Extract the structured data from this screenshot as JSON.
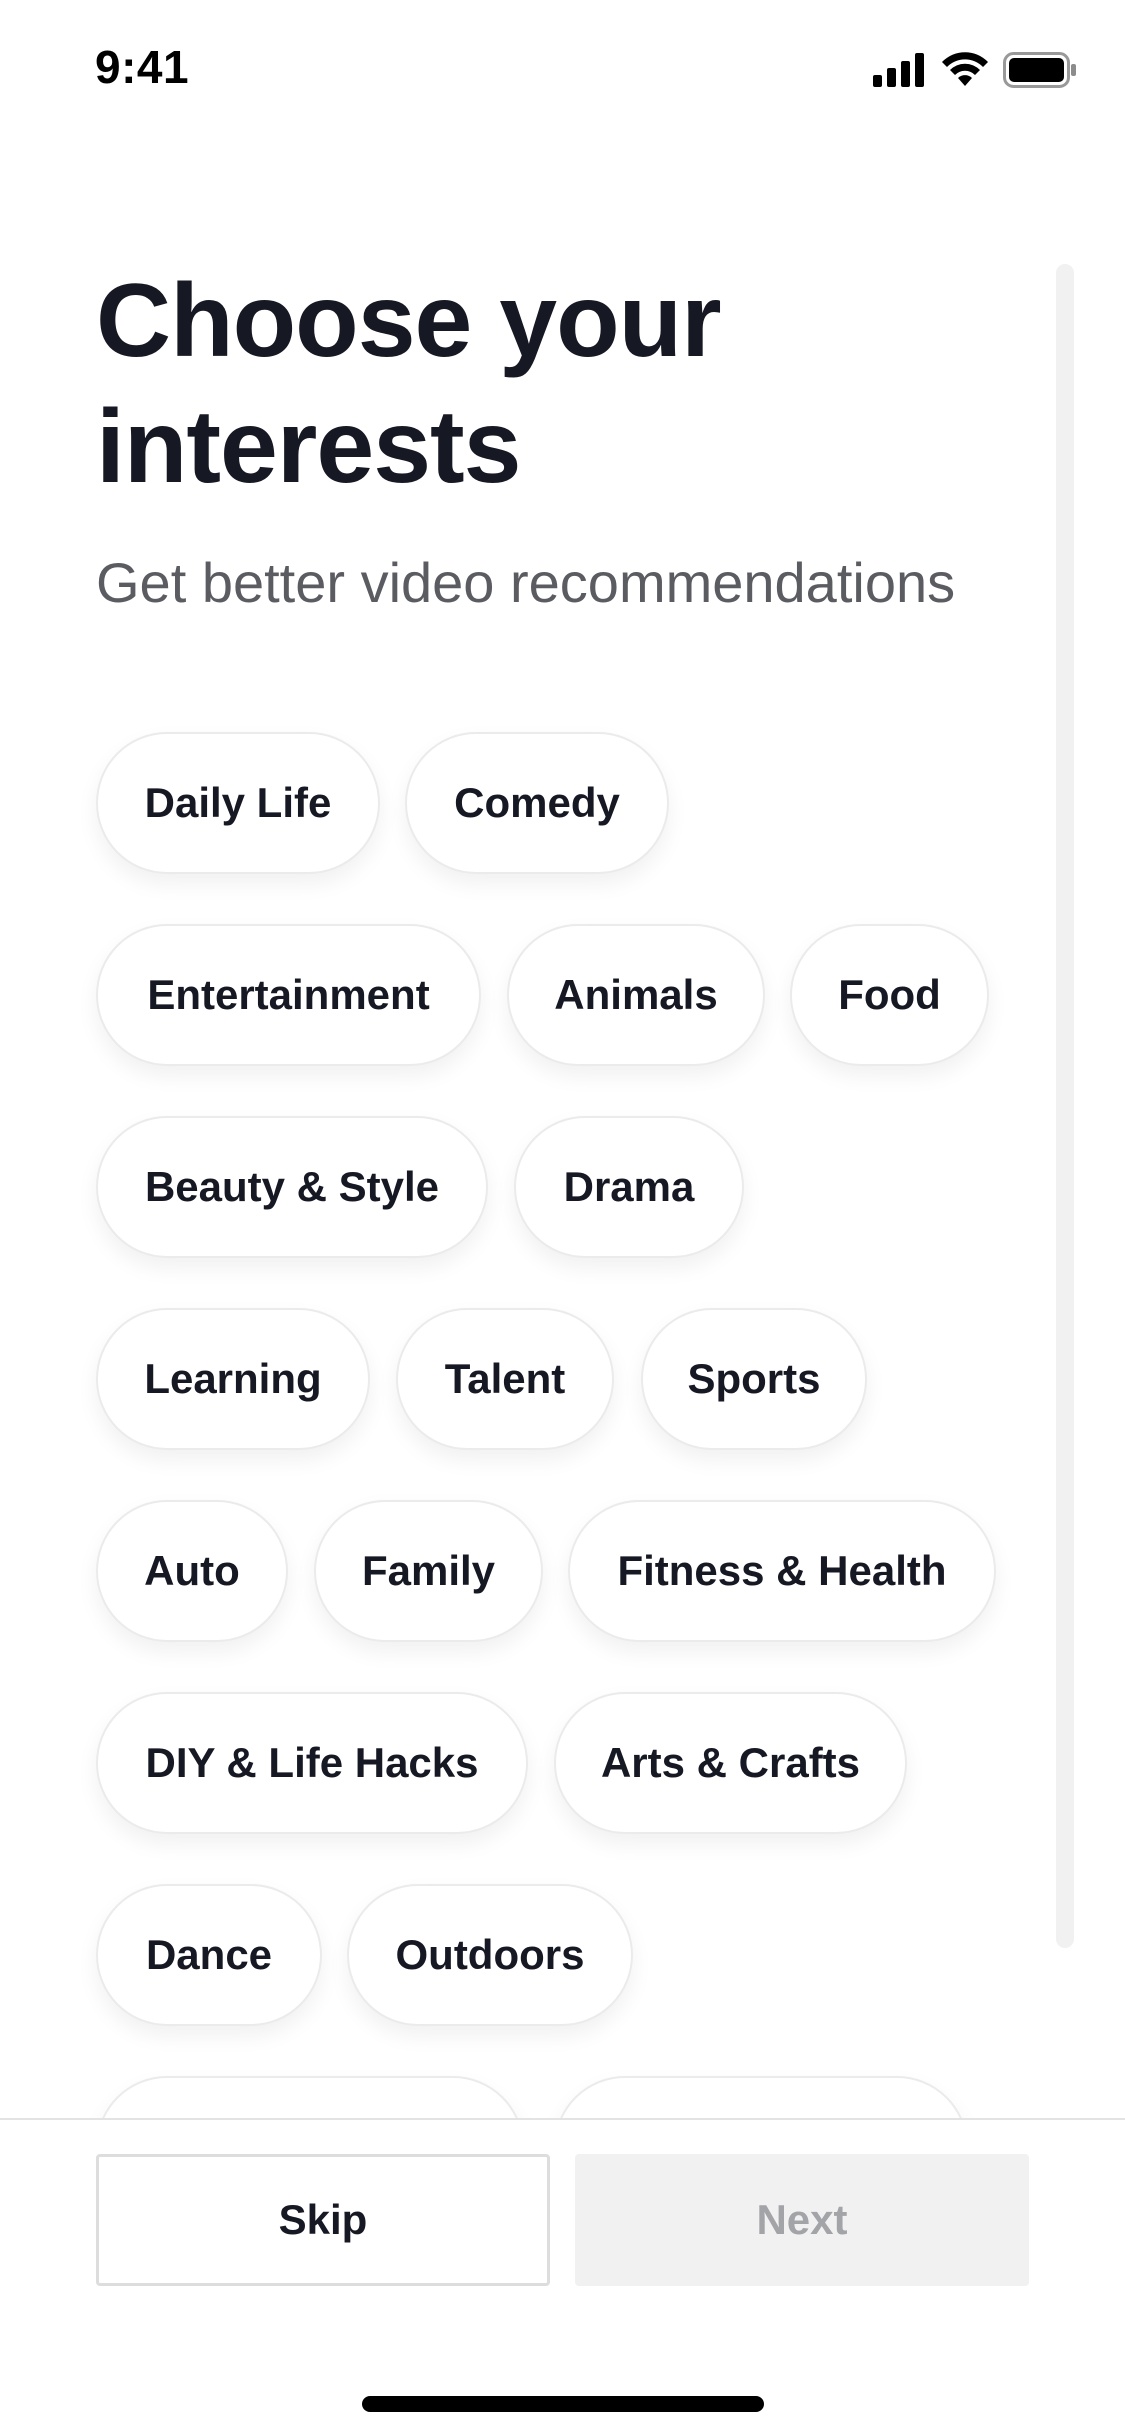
{
  "status_bar": {
    "time": "9:41",
    "icons": [
      "cellular-signal-icon",
      "wifi-icon",
      "battery-icon"
    ]
  },
  "header": {
    "title": "Choose your interests",
    "subtitle": "Get better video recommendations"
  },
  "interests": [
    "Daily Life",
    "Comedy",
    "Entertainment",
    "Animals",
    "Food",
    "Beauty & Style",
    "Drama",
    "Learning",
    "Talent",
    "Sports",
    "Auto",
    "Family",
    "Fitness & Health",
    "DIY & Life Hacks",
    "Arts & Crafts",
    "Dance",
    "Outdoors"
  ],
  "footer": {
    "skip_label": "Skip",
    "next_label": "Next"
  },
  "colors": {
    "text_primary": "#161823",
    "text_secondary": "#5b5c61",
    "disabled_button_bg": "#f1f1f2",
    "disabled_button_text": "#a3a4a8"
  }
}
